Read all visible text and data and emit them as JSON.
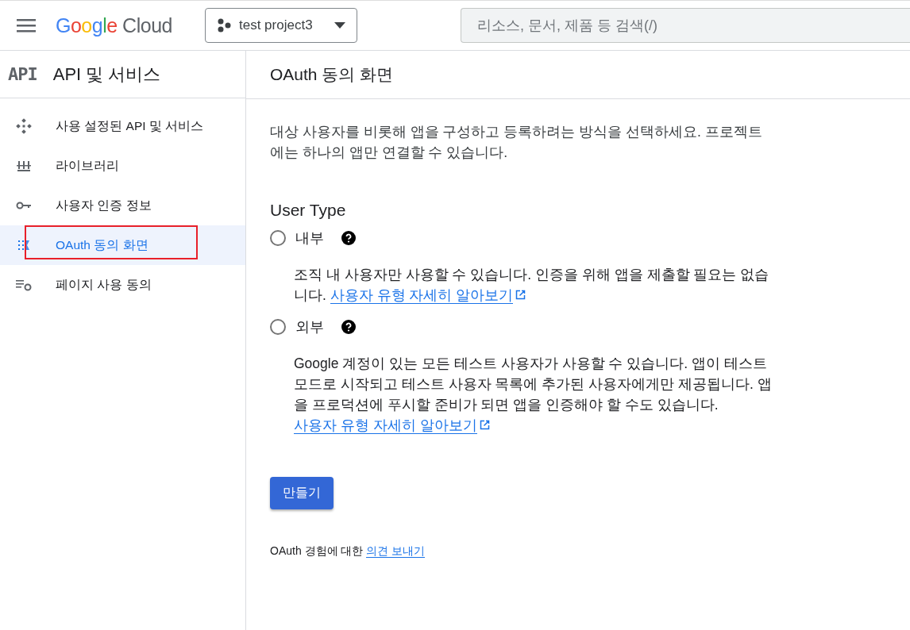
{
  "top_bar": {
    "logo": "Google Cloud",
    "project": "test project3",
    "search": {
      "placeholder": "리소스, 문서, 제품 등 검색(/)"
    }
  },
  "sidebar": {
    "header_icon": "API",
    "title": "API 및 서비스",
    "items": [
      {
        "kind": "apis",
        "label": "사용 설정된 API 및 서비스",
        "selected": false,
        "highlighted": false
      },
      {
        "kind": "library",
        "label": "라이브러리",
        "selected": false,
        "highlighted": false
      },
      {
        "kind": "credentials",
        "label": "사용자 인증 정보",
        "selected": false,
        "highlighted": false
      },
      {
        "kind": "consent",
        "label": "OAuth 동의 화면",
        "selected": true,
        "highlighted": true
      },
      {
        "kind": "terms",
        "label": "페이지 사용 동의",
        "selected": false,
        "highlighted": false
      }
    ]
  },
  "main": {
    "title": "OAuth 동의 화면",
    "intro": "대상 사용자를 비롯해 앱을 구성하고 등록하려는 방식을 선택하세요. 프로젝트에는 하나의 앱만 연결할 수 있습니다.",
    "section_title": "User Type",
    "options": [
      {
        "label": "내부",
        "selected": false,
        "description": "조직 내 사용자만 사용할 수 있습니다. 인증을 위해 앱을 제출할 필요는 없습니다.",
        "link": "사용자 유형 자세히 알아보기"
      },
      {
        "label": "외부",
        "selected": false,
        "description": "Google 계정이 있는 모든 테스트 사용자가 사용할 수 있습니다. 앱이 테스트 모드로 시작되고 테스트 사용자 목록에 추가된 사용자에게만 제공됩니다. 앱을 프로덕션에 푸시할 준비가 되면 앱을 인증해야 할 수도 있습니다.",
        "link": "사용자 유형 자세히 알아보기"
      }
    ],
    "create_button": "만들기",
    "feedback_text": "OAuth 경험에 대한",
    "feedback_link": "의견 보내기"
  }
}
